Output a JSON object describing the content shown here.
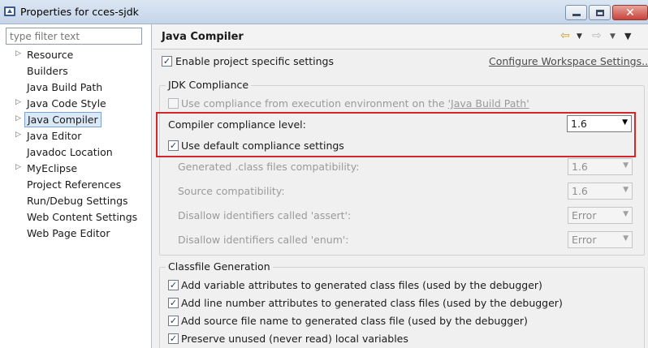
{
  "window": {
    "title": "Properties for cces-sjdk"
  },
  "sidebar": {
    "filter_placeholder": "type filter text",
    "items": [
      {
        "label": "Resource",
        "expandable": true
      },
      {
        "label": "Builders",
        "expandable": false
      },
      {
        "label": "Java Build Path",
        "expandable": false
      },
      {
        "label": "Java Code Style",
        "expandable": true
      },
      {
        "label": "Java Compiler",
        "expandable": true,
        "selected": true
      },
      {
        "label": "Java Editor",
        "expandable": true
      },
      {
        "label": "Javadoc Location",
        "expandable": false
      },
      {
        "label": "MyEclipse",
        "expandable": true
      },
      {
        "label": "Project References",
        "expandable": false
      },
      {
        "label": "Run/Debug Settings",
        "expandable": false
      },
      {
        "label": "Web Content Settings",
        "expandable": false
      },
      {
        "label": "Web Page Editor",
        "expandable": false
      }
    ]
  },
  "page": {
    "title": "Java Compiler",
    "enable_specific": {
      "label": "Enable project specific settings",
      "checked": true
    },
    "configure_link": "Configure Workspace Settings...",
    "jdk_compliance": {
      "group_title": "JDK Compliance",
      "use_env": {
        "label_prefix": "Use compliance from execution environment on the ",
        "link": "'Java Build Path'",
        "checked": false
      },
      "compliance_level": {
        "label": "Compiler compliance level:",
        "value": "1.6"
      },
      "use_default": {
        "label": "Use default compliance settings",
        "checked": true
      },
      "generated_compat": {
        "label": "Generated .class files compatibility:",
        "value": "1.6"
      },
      "source_compat": {
        "label": "Source compatibility:",
        "value": "1.6"
      },
      "assert_ident": {
        "label": "Disallow identifiers called 'assert':",
        "value": "Error"
      },
      "enum_ident": {
        "label": "Disallow identifiers called 'enum':",
        "value": "Error"
      }
    },
    "classfile": {
      "group_title": "Classfile Generation",
      "options": [
        {
          "label": "Add variable attributes to generated class files (used by the debugger)",
          "checked": true
        },
        {
          "label": "Add line number attributes to generated class files (used by the debugger)",
          "checked": true
        },
        {
          "label": "Add source file name to generated class file (used by the debugger)",
          "checked": true
        },
        {
          "label": "Preserve unused (never read) local variables",
          "checked": true
        }
      ]
    }
  },
  "icons": {
    "check_glyph": "✓",
    "expand_glyph": "▷",
    "dropdown_glyph": "▼",
    "back_glyph": "⇦",
    "forward_glyph": "⇨",
    "close_glyph": "✕"
  },
  "colors": {
    "highlight_border": "#d4262b",
    "selection_bg": "#dae9f8"
  }
}
